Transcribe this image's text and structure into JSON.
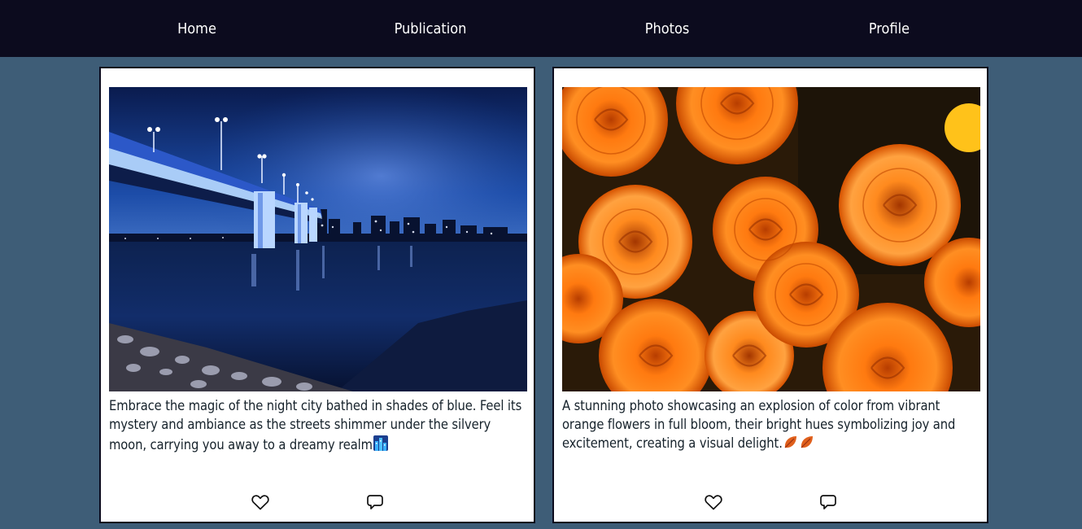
{
  "nav": {
    "items": [
      {
        "label": "Home"
      },
      {
        "label": "Publication"
      },
      {
        "label": "Photos"
      },
      {
        "label": "Profile"
      }
    ]
  },
  "posts": [
    {
      "photo_subject": "night city bridge over water in blue tones",
      "caption": "Embrace the magic of the night city bathed in shades of blue. Feel its mystery and ambiance as the streets shimmer under the silvery moon, carrying you away to a dreamy realm",
      "caption_emoji": "cityscape-at-night-icon",
      "like_icon": "heart-icon",
      "comment_icon": "speech-bubble-icon"
    },
    {
      "photo_subject": "bouquet of orange roses",
      "caption": "A stunning photo showcasing an explosion of color from vibrant orange flowers in full bloom, their bright hues symbolizing joy and excitement, creating a visual delight.",
      "caption_emoji": "fallen-leaf-icon",
      "like_icon": "heart-icon",
      "comment_icon": "speech-bubble-icon"
    }
  ],
  "colors": {
    "nav_background": "#0c0b1e",
    "page_background": "#3e5d77",
    "card_background": "#ffffff",
    "card_border": "#0c0b1e",
    "caption_text": "#16222b"
  }
}
